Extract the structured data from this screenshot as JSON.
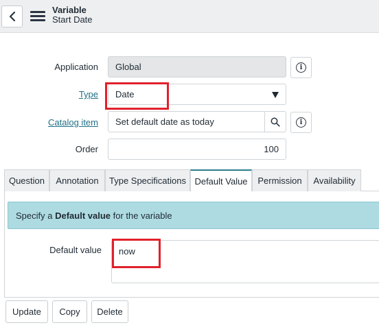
{
  "header": {
    "title": "Variable",
    "subtitle": "Start Date"
  },
  "form": {
    "application": {
      "label": "Application",
      "value": "Global"
    },
    "type": {
      "label": "Type",
      "value": "Date"
    },
    "catalog_item": {
      "label": "Catalog item",
      "value": "Set default date as today"
    },
    "order": {
      "label": "Order",
      "value": "100"
    }
  },
  "tabs": [
    {
      "label": "Question"
    },
    {
      "label": "Annotation"
    },
    {
      "label": "Type Specifications"
    },
    {
      "label": "Default Value"
    },
    {
      "label": "Permission"
    },
    {
      "label": "Availability"
    }
  ],
  "default_value_section": {
    "notice_prefix": "Specify a ",
    "notice_bold": "Default value",
    "notice_suffix": " for the variable",
    "field_label": "Default value",
    "field_value": "now"
  },
  "buttons": {
    "update": "Update",
    "copy": "Copy",
    "delete": "Delete"
  },
  "colors": {
    "highlight": "#e1202b",
    "notice_bg": "#aedbe1",
    "link": "#1f7086",
    "active_tab": "#2a7d8e"
  }
}
